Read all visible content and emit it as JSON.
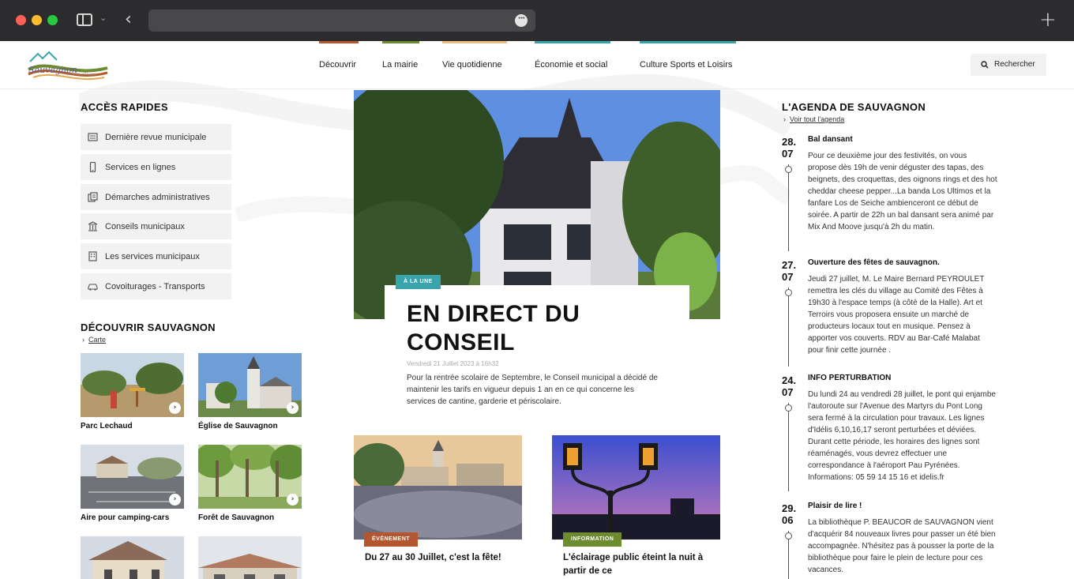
{
  "browser": {
    "url": ""
  },
  "header": {
    "logo_text": "Sauvagnon",
    "logo_tagline": "Le vrai village",
    "nav": [
      {
        "label": "Découvrir",
        "color": "#b45a2c"
      },
      {
        "label": "La mairie",
        "color": "#6d8b2f"
      },
      {
        "label": "Vie quotidienne",
        "color": "#f0c080"
      },
      {
        "label": "Économie et social",
        "color": "#3aa4ad"
      },
      {
        "label": "Culture Sports et Loisirs",
        "color": "#3aa4ad"
      }
    ],
    "search_label": "Rechercher"
  },
  "quick_access": {
    "title": "ACCÈS RAPIDES",
    "items": [
      {
        "label": "Dernière revue municipale",
        "icon": "newspaper-icon"
      },
      {
        "label": "Services en lignes",
        "icon": "phone-icon"
      },
      {
        "label": "Démarches administratives",
        "icon": "documents-icon"
      },
      {
        "label": "Conseils municipaux",
        "icon": "town-hall-icon"
      },
      {
        "label": "Les services municipaux",
        "icon": "building-icon"
      },
      {
        "label": "Covoiturages - Transports",
        "icon": "car-icon"
      }
    ]
  },
  "discover": {
    "title": "DÉCOUVRIR SAUVAGNON",
    "link": "Carte",
    "cards": [
      {
        "title": "Parc Lechaud"
      },
      {
        "title": "Église de Sauvagnon"
      },
      {
        "title": "Aire pour camping-cars"
      },
      {
        "title": "Forêt de Sauvagnon"
      },
      {
        "title": ""
      },
      {
        "title": ""
      }
    ]
  },
  "featured": {
    "badge": "À LA UNE",
    "title": "EN DIRECT DU CONSEIL",
    "date": "Vendredi 21 Juillet 2023 à 16h32",
    "text": "Pour la rentrée scolaire de Septembre, le Conseil municipal a décidé de maintenir les tarifs en vigueur depuis 1 an en ce qui concerne les services de cantine, garderie et périscolaire."
  },
  "news": [
    {
      "badge": "ÉVÉNEMENT",
      "badge_color": "#b4562e",
      "title": "Du 27 au 30 Juillet, c'est la fête!"
    },
    {
      "badge": "INFORMATION",
      "badge_color": "#6d8b2f",
      "title": "L'éclairage public éteint la nuit à partir de ce"
    }
  ],
  "agenda": {
    "title": "L'AGENDA DE SAUVAGNON",
    "link": "Voir tout l'agenda",
    "events": [
      {
        "day": "28.",
        "month": "07",
        "title": "Bal dansant",
        "text": "Pour ce deuxième jour des festivités, on vous propose dès 19h de venir déguster des tapas, des beignets, des croquettas, des oignons rings et des hot cheddar cheese pepper...La banda Los Ultimos et la fanfare Los de Seiche ambienceront ce début de soirée. A partir de 22h un bal dansant sera animé par Mix And Moove jusqu'à 2h du matin."
      },
      {
        "day": "27.",
        "month": "07",
        "title": "Ouverture des fêtes de sauvagnon.",
        "text": "Jeudi 27 juillet, M. Le Maire Bernard PEYROULET remettra les clés du village au Comité des Fêtes à 19h30 à l'espace temps (à côté de la Halle). Art et Terroirs vous proposera ensuite un marché de producteurs locaux tout en musique. Pensez à apporter vos couverts. RDV au Bar-Café Malabat pour finir cette journée ."
      },
      {
        "day": "24.",
        "month": "07",
        "title": "INFO PERTURBATION",
        "text": "Du lundi 24 au vendredi 28 juillet, le pont qui enjambe l'autoroute sur l'Avenue des Martyrs du Pont Long sera fermé à la circulation pour travaux. Les lignes d'Idélis 6,10,16,17 seront perturbées et déviées. Durant cette période, les horaires des lignes sont réaménagés, vous devrez effectuer une correspondance à l'aéroport Pau Pyrénées. Informations: 05 59 14 15 16 et idelis.fr"
      },
      {
        "day": "29.",
        "month": "06",
        "title": "Plaisir de lire !",
        "text": "La bibliothèque P. BEAUCOR de SAUVAGNON vient d'acquérir 84 nouveaux livres pour passer un été bien accompagnée. N'hésitez pas à pousser la porte de la bibliothèque pour faire le plein de lecture pour ces vacances."
      }
    ]
  }
}
